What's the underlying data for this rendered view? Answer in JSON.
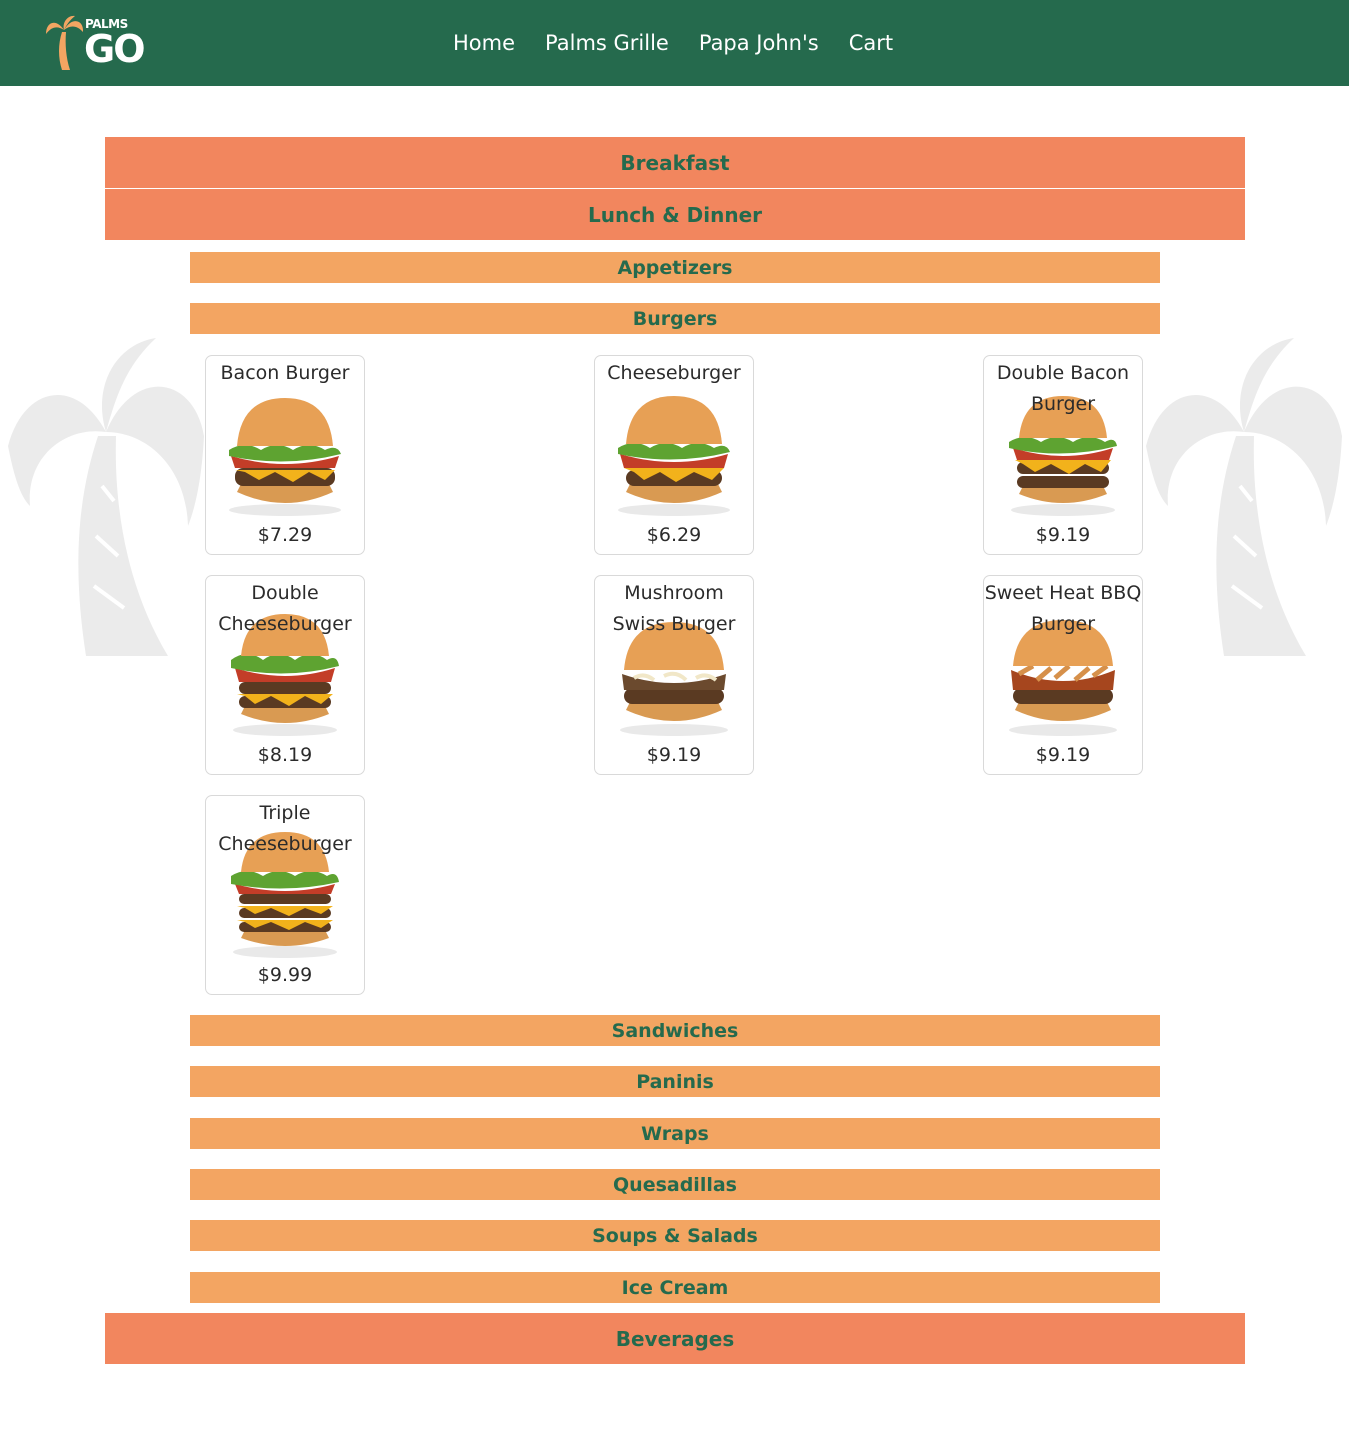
{
  "brand": {
    "logo_top_text": "PALMS",
    "logo_main_text": "GO",
    "primary_color": "#256a4d",
    "accent_color": "#f3a562"
  },
  "nav": {
    "home": "Home",
    "palms_grille": "Palms Grille",
    "papa_johns": "Papa John's",
    "cart": "Cart"
  },
  "menu": {
    "categories": {
      "breakfast": "Breakfast",
      "lunch_dinner": "Lunch & Dinner",
      "beverages": "Beverages"
    },
    "subcategories": {
      "appetizers": "Appetizers",
      "burgers": "Burgers",
      "sandwiches": "Sandwiches",
      "paninis": "Paninis",
      "wraps": "Wraps",
      "quesadillas": "Quesadillas",
      "soups_salads": "Soups & Salads",
      "ice_cream": "Ice Cream"
    },
    "burgers": [
      {
        "name": "Bacon Burger",
        "price": "$7.29"
      },
      {
        "name": "Cheeseburger",
        "price": "$6.29"
      },
      {
        "name": "Double Bacon Burger",
        "price": "$9.19"
      },
      {
        "name": "Double Cheeseburger",
        "price": "$8.19"
      },
      {
        "name": "Mushroom Swiss Burger",
        "price": "$9.19"
      },
      {
        "name": "Sweet Heat BBQ Burger",
        "price": "$9.19"
      },
      {
        "name": "Triple Cheeseburger",
        "price": "$9.99"
      }
    ]
  }
}
